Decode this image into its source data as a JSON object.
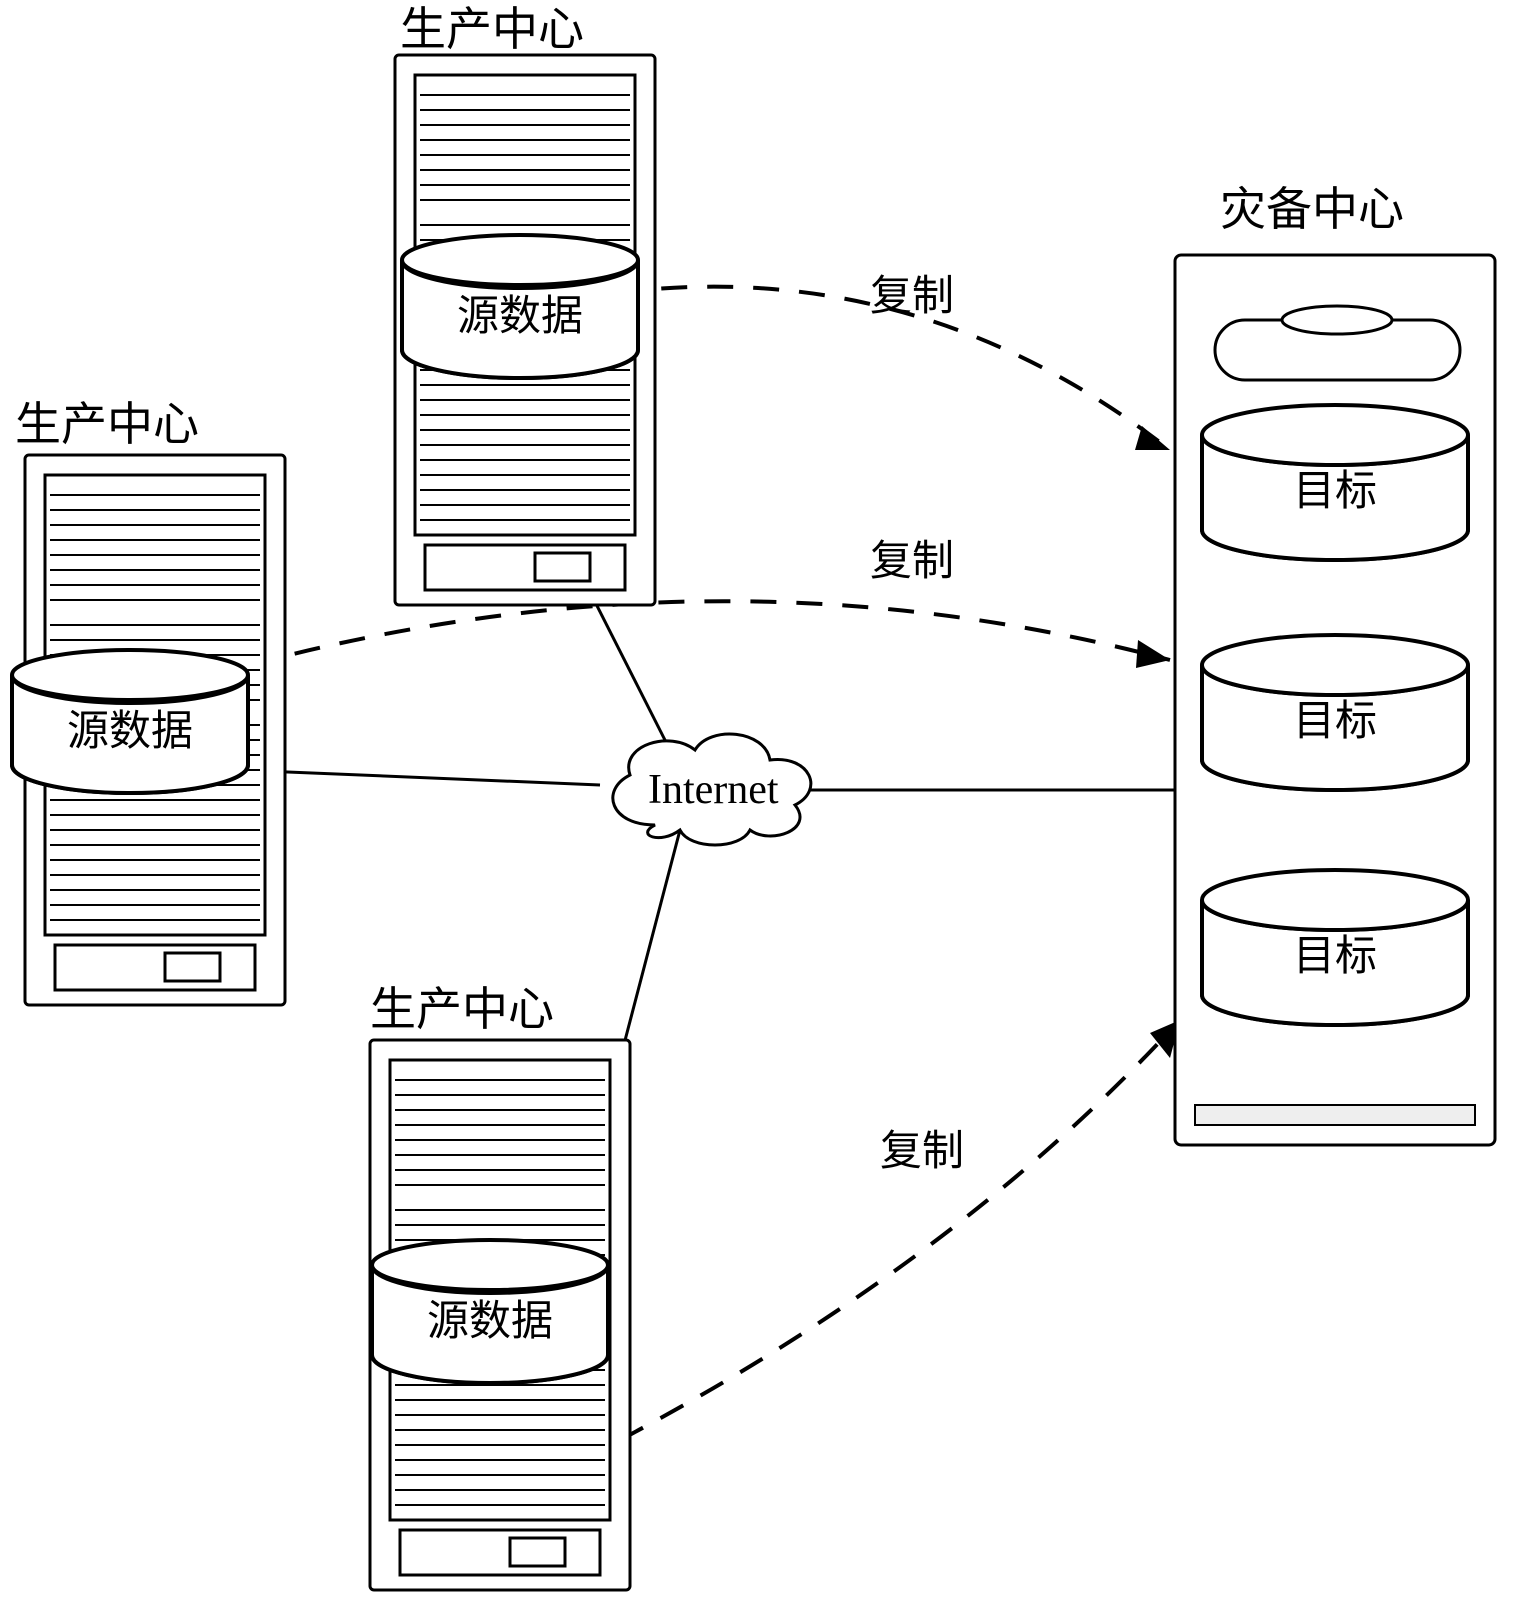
{
  "diagram": {
    "producers": [
      {
        "title": "生产中心",
        "data_label": "源数据"
      },
      {
        "title": "生产中心",
        "data_label": "源数据"
      },
      {
        "title": "生产中心",
        "data_label": "源数据"
      }
    ],
    "dr_center": {
      "title": "灾备中心",
      "targets": [
        "目标",
        "目标",
        "目标"
      ]
    },
    "cloud_label": "Internet",
    "link_labels": {
      "copy1": "复制",
      "copy2": "复制",
      "copy3": "复制"
    }
  }
}
